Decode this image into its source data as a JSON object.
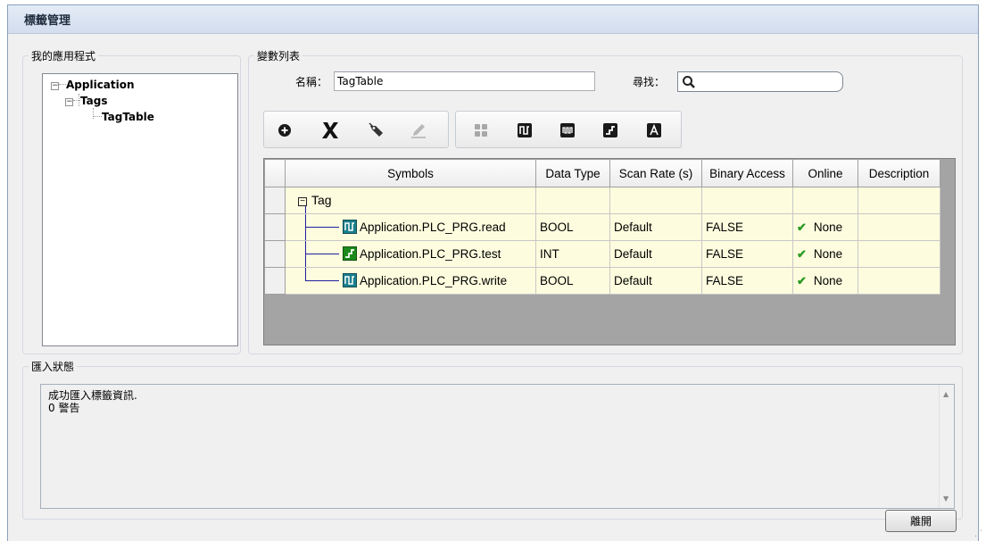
{
  "window": {
    "title": "標籤管理"
  },
  "app_group": {
    "label": "我的應用程式",
    "tree": [
      {
        "label": "Application",
        "expander": "−"
      },
      {
        "label": "Tags",
        "expander": "−"
      },
      {
        "label": "TagTable"
      }
    ]
  },
  "var_group": {
    "label": "變數列表",
    "name_label": "名稱：",
    "name_value": "TagTable",
    "search_label": "尋找：",
    "search_value": ""
  },
  "toolbar": {
    "left": [
      {
        "icon": "add-circle-icon"
      },
      {
        "icon": "delete-x-icon"
      },
      {
        "icon": "tag-edit-icon"
      },
      {
        "icon": "pencil-icon"
      }
    ],
    "right": [
      {
        "icon": "grid-tiles-icon"
      },
      {
        "icon": "pulse-bool-icon"
      },
      {
        "icon": "wave-signal-icon"
      },
      {
        "icon": "step-int-icon"
      },
      {
        "icon": "text-a-icon"
      }
    ]
  },
  "grid": {
    "columns": [
      "Symbols",
      "Data Type",
      "Scan Rate (s)",
      "Binary Access",
      "Online",
      "Description"
    ],
    "group": {
      "expander": "−",
      "label": "Tag"
    },
    "rows": [
      {
        "symbol": "Application.PLC_PRG.read",
        "data_type": "BOOL",
        "scan_rate": "Default",
        "binary_access": "FALSE",
        "online": "None",
        "description": "",
        "icon": "bool-tag-icon"
      },
      {
        "symbol": "Application.PLC_PRG.test",
        "data_type": "INT",
        "scan_rate": "Default",
        "binary_access": "FALSE",
        "online": "None",
        "description": "",
        "icon": "int-tag-icon"
      },
      {
        "symbol": "Application.PLC_PRG.write",
        "data_type": "BOOL",
        "scan_rate": "Default",
        "binary_access": "FALSE",
        "online": "None",
        "description": "",
        "icon": "bool-tag-icon"
      }
    ]
  },
  "import_group": {
    "label": "匯入狀態",
    "lines": [
      "成功匯入標籤資訊.",
      "0 警告"
    ]
  },
  "footer": {
    "close_label": "離開"
  },
  "colors": {
    "bool_icon": "#1a7f8c",
    "int_icon": "#1b8a1b",
    "tree_line": "#1f1f9e",
    "row_bg": "#fdfcde"
  }
}
